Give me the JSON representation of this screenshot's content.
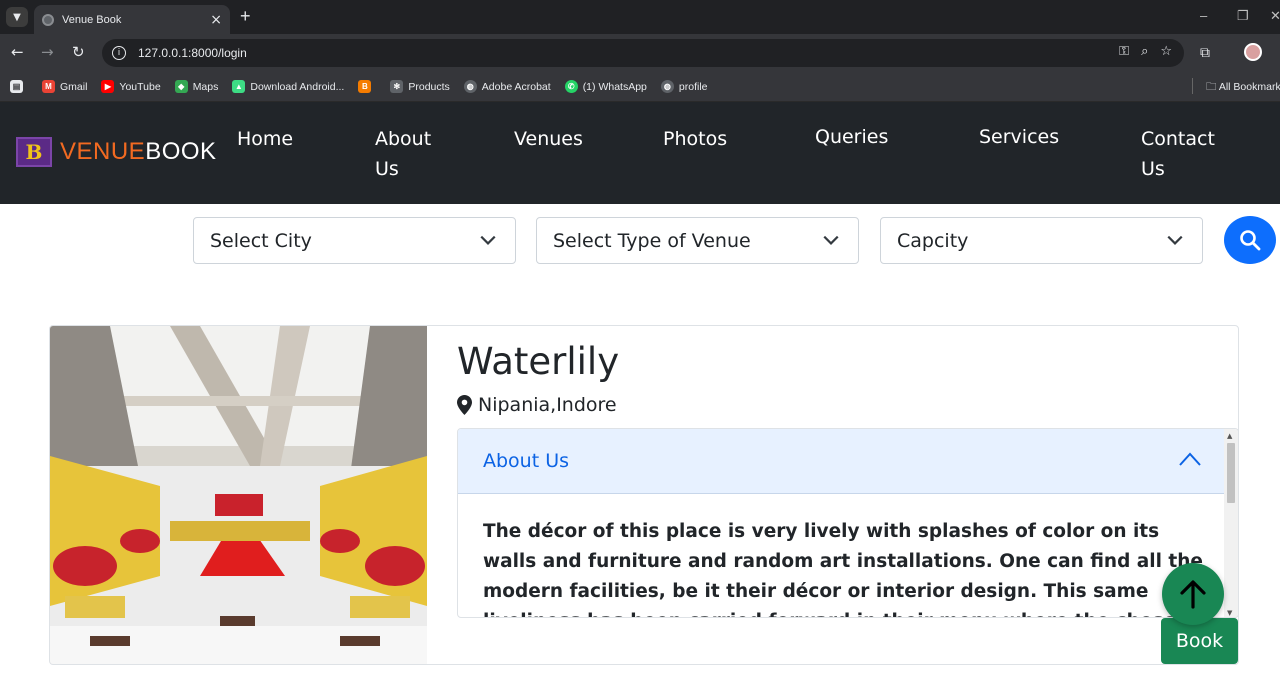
{
  "browser": {
    "tab_title": "Venue Book",
    "tab_close": "×",
    "new_tab": "+",
    "url": "127.0.0.1:8000/login",
    "win_min": "–",
    "win_max": "❐",
    "win_close": "✕",
    "bookmarks": [
      {
        "label": "Gmail",
        "icon": "gmail-icon",
        "color": "#ea4335",
        "glyph": "M"
      },
      {
        "label": "YouTube",
        "icon": "youtube-icon",
        "color": "#ff0000",
        "glyph": "▶"
      },
      {
        "label": "Maps",
        "icon": "maps-icon",
        "color": "#34a853",
        "glyph": "◆"
      },
      {
        "label": "Download Android...",
        "icon": "android-icon",
        "color": "#3ddc84",
        "glyph": "▲"
      },
      {
        "label": "",
        "icon": "blogger-icon",
        "color": "#f57c00",
        "glyph": "B"
      },
      {
        "label": "Products",
        "icon": "react-icon",
        "color": "#5f6368",
        "glyph": "✻"
      },
      {
        "label": "Adobe Acrobat",
        "icon": "globe-icon",
        "color": "#5f6368",
        "glyph": "◍"
      },
      {
        "label": "(1) WhatsApp",
        "icon": "whatsapp-icon",
        "color": "#25d366",
        "glyph": "✆"
      },
      {
        "label": "profile",
        "icon": "globe-icon",
        "color": "#5f6368",
        "glyph": "◍"
      }
    ],
    "all_bookmarks": "All Bookmarks"
  },
  "nav": {
    "logo_part1": "VENUE",
    "logo_part2": "BOOK",
    "logo_letter": "B",
    "links": {
      "home": "Home",
      "about_1": "About",
      "about_2": "Us",
      "venues": "Venues",
      "photos": "Photos",
      "queries": "Queries",
      "services": "Services",
      "contact_1": "Contact",
      "contact_2": "Us"
    }
  },
  "filters": {
    "city": "Select City",
    "venue_type": "Select Type of Venue",
    "capacity": "Capcity"
  },
  "venue": {
    "name": "Waterlily",
    "location": "Nipania,Indore",
    "about_header": "About Us",
    "about_text": "The décor of this place is very lively with splashes of color on its walls and furniture and random art installations. One can find all the modern facilities, be it their décor or interior design. This same liveliness has been carried forward in their menu where the chosen cuisines are local",
    "book_label": "Book"
  },
  "colors": {
    "navbar": "#212529",
    "primary": "#0d6efd",
    "success": "#198754",
    "logo_orange": "#f26a21"
  }
}
